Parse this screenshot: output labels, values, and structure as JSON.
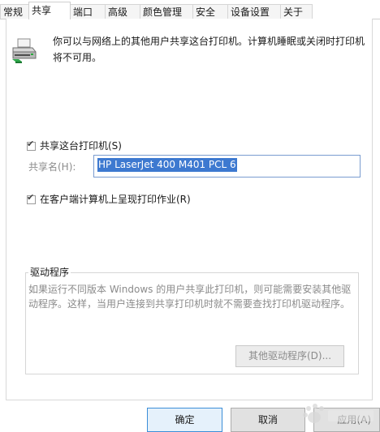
{
  "tabs": [
    {
      "label": "常规",
      "active": false
    },
    {
      "label": "共享",
      "active": true
    },
    {
      "label": "端口",
      "active": false
    },
    {
      "label": "高级",
      "active": false
    },
    {
      "label": "颜色管理",
      "active": false
    },
    {
      "label": "安全",
      "active": false
    },
    {
      "label": "设备设置",
      "active": false
    },
    {
      "label": "关于",
      "active": false
    }
  ],
  "intro": {
    "icon": "printer-icon",
    "text": "你可以与网络上的其他用户共享这台打印机。计算机睡眠或关闭时打印机将不可用。"
  },
  "share": {
    "checkbox_label": "共享这台打印机(S)",
    "checked": true,
    "name_label": "共享名(H):",
    "name_value": "HP LaserJet 400 M401 PCL 6"
  },
  "render": {
    "checkbox_label": "在客户端计算机上呈现打印作业(R)",
    "checked": true
  },
  "drivers": {
    "group_title": "驱动程序",
    "description": "如果运行不同版本 Windows 的用户共享此打印机，则可能需要安装其他驱动程序。这样，当用户连接到共享打印机时就不需要查找打印机驱动程序。",
    "button_label": "其他驱动程序(D)..."
  },
  "buttons": {
    "ok": "确定",
    "cancel": "取消",
    "apply": "应用(A)"
  },
  "colors": {
    "selection": "#3d79d0",
    "focus_border": "#3c8ed8"
  }
}
